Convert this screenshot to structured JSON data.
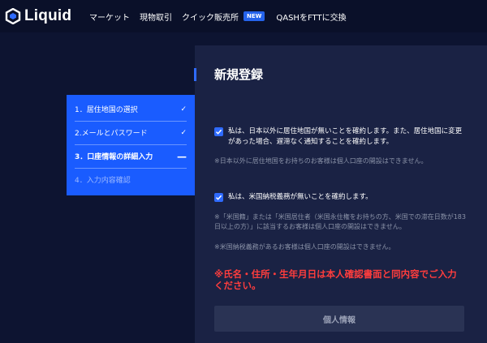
{
  "header": {
    "logo_text": "Liquid",
    "nav": [
      "マーケット",
      "現物取引",
      "クイック販売所",
      "QASHをFTTに交換"
    ],
    "new_badge": "NEW"
  },
  "steps": [
    {
      "label": "1．居住地国の選択",
      "state": "done",
      "icon": "✓"
    },
    {
      "label": "2.メールとパスワード",
      "state": "done",
      "icon": "✓"
    },
    {
      "label": "3．口座情報の詳細入力",
      "state": "current",
      "icon": "—"
    },
    {
      "label": "4．入力内容確認",
      "state": "pending",
      "icon": ""
    }
  ],
  "form": {
    "title": "新規登録",
    "residence_check": {
      "checked": true,
      "label": "私は、日本以外に居住地国が無いことを確約します。また、居住地国に変更があった場合、遅滞なく通知することを確約します。"
    },
    "residence_note": "※日本以外に居住地国をお持ちのお客様は個人口座の開設はできません。",
    "us_tax_check": {
      "checked": true,
      "label": "私は、米国納税義務が無いことを確約します。"
    },
    "us_note_1": "※「米国籍」または「米国居住者（米国永住権をお持ちの方、米国での滞在日数が183日以上の方）」に該当するお客様は個人口座の開設はできません。",
    "us_note_2": "※米国納税義務があるお客様は個人口座の開設はできません。",
    "warning": "※氏名・住所・生年月日は本人確認書面と同内容でご入力ください。",
    "submit_label": "個人情報"
  },
  "colors": {
    "background": "#0d1431",
    "panel": "#1a2244",
    "accent": "#1a5cff",
    "warning": "#ff3d3d"
  }
}
